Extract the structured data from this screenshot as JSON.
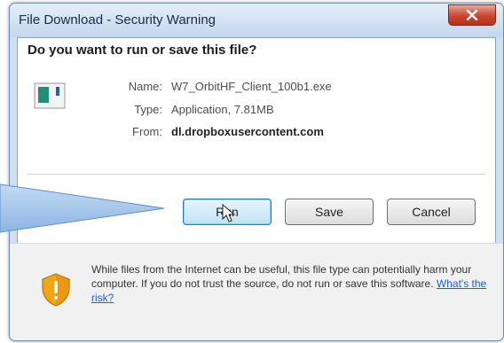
{
  "dialog": {
    "title": "File Download - Security Warning",
    "question": "Do you want to run or save this file?",
    "fields": {
      "name_label": "Name:",
      "name_value": "W7_OrbitHF_Client_100b1.exe",
      "type_label": "Type:",
      "type_value": "Application, 7.81MB",
      "from_label": "From:",
      "from_value": "dl.dropboxusercontent.com"
    },
    "buttons": {
      "run": "Run",
      "save": "Save",
      "cancel": "Cancel"
    },
    "warning": {
      "text": "While files from the Internet can be useful, this file type can potentially harm your computer. If you do not trust the source, do not run or save this software.",
      "link": "What's the risk?"
    }
  },
  "icons": {
    "close": "close-icon",
    "file": "application-file-icon",
    "shield": "security-shield-icon",
    "pointer": "mouse-pointer-icon",
    "callout": "callout-arrow"
  },
  "colors": {
    "window_frame": "#cfe0f1",
    "close_button": "#c8452f",
    "default_button": "#bfe2f7",
    "callout_arrow": "#9fc3ea",
    "link": "#1f5fbf"
  }
}
